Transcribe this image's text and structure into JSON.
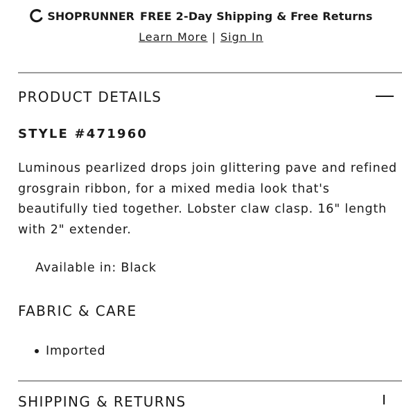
{
  "banner": {
    "brand": "SHOPRUNNER",
    "tagline": "FREE 2-Day Shipping & Free Returns",
    "learn_more": "Learn More",
    "separator": "|",
    "sign_in": "Sign In"
  },
  "product_details": {
    "title": "PRODUCT DETAILS",
    "toggle_icon": "minus-icon",
    "style": "STYLE #471960",
    "description": "Luminous pearlized drops join glittering pave and refined grosgrain ribbon, for a mixed media look that's beautifully tied together. Lobster claw clasp. 16\" length with 2\" extender.",
    "availability": "Available in: Black"
  },
  "fabric_care": {
    "title": "FABRIC & CARE",
    "items": [
      "Imported"
    ]
  },
  "shipping_returns": {
    "title": "SHIPPING & RETURNS",
    "toggle_icon": "plus-icon"
  }
}
